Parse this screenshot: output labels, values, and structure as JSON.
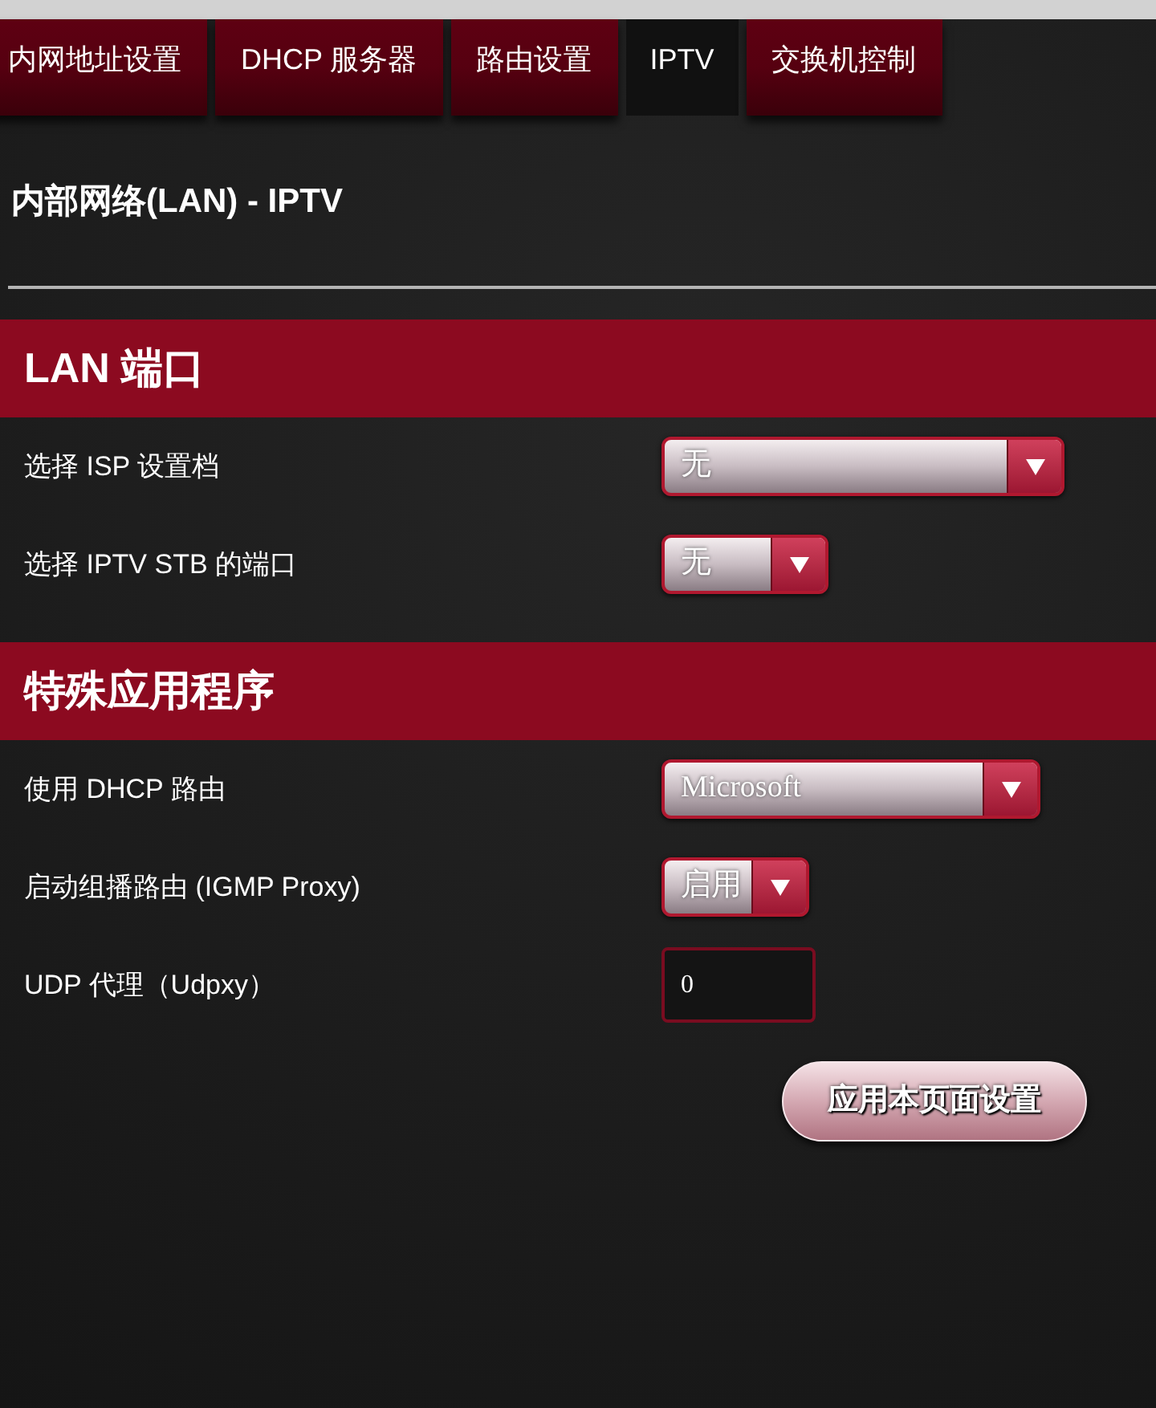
{
  "tabs": [
    {
      "label": "内网地址设置",
      "selected": false
    },
    {
      "label": "DHCP 服务器",
      "selected": false
    },
    {
      "label": "路由设置",
      "selected": false
    },
    {
      "label": "IPTV",
      "selected": true
    },
    {
      "label": "交换机控制",
      "selected": false
    }
  ],
  "page_title": "内部网络(LAN) - IPTV",
  "sections": [
    {
      "title": "LAN 端口",
      "fields": [
        {
          "kind": "select",
          "label": "选择 ISP 设置档",
          "value": "无"
        },
        {
          "kind": "select",
          "label": "选择 IPTV STB 的端口",
          "value": "无"
        }
      ]
    },
    {
      "title": "特殊应用程序",
      "fields": [
        {
          "kind": "select",
          "label": "使用 DHCP 路由",
          "value": "Microsoft"
        },
        {
          "kind": "select",
          "label": "启动组播路由 (IGMP Proxy)",
          "value": "启用"
        },
        {
          "kind": "input",
          "label": "UDP 代理（Udpxy）",
          "value": "0"
        }
      ]
    }
  ],
  "apply_button": "应用本页面设置"
}
